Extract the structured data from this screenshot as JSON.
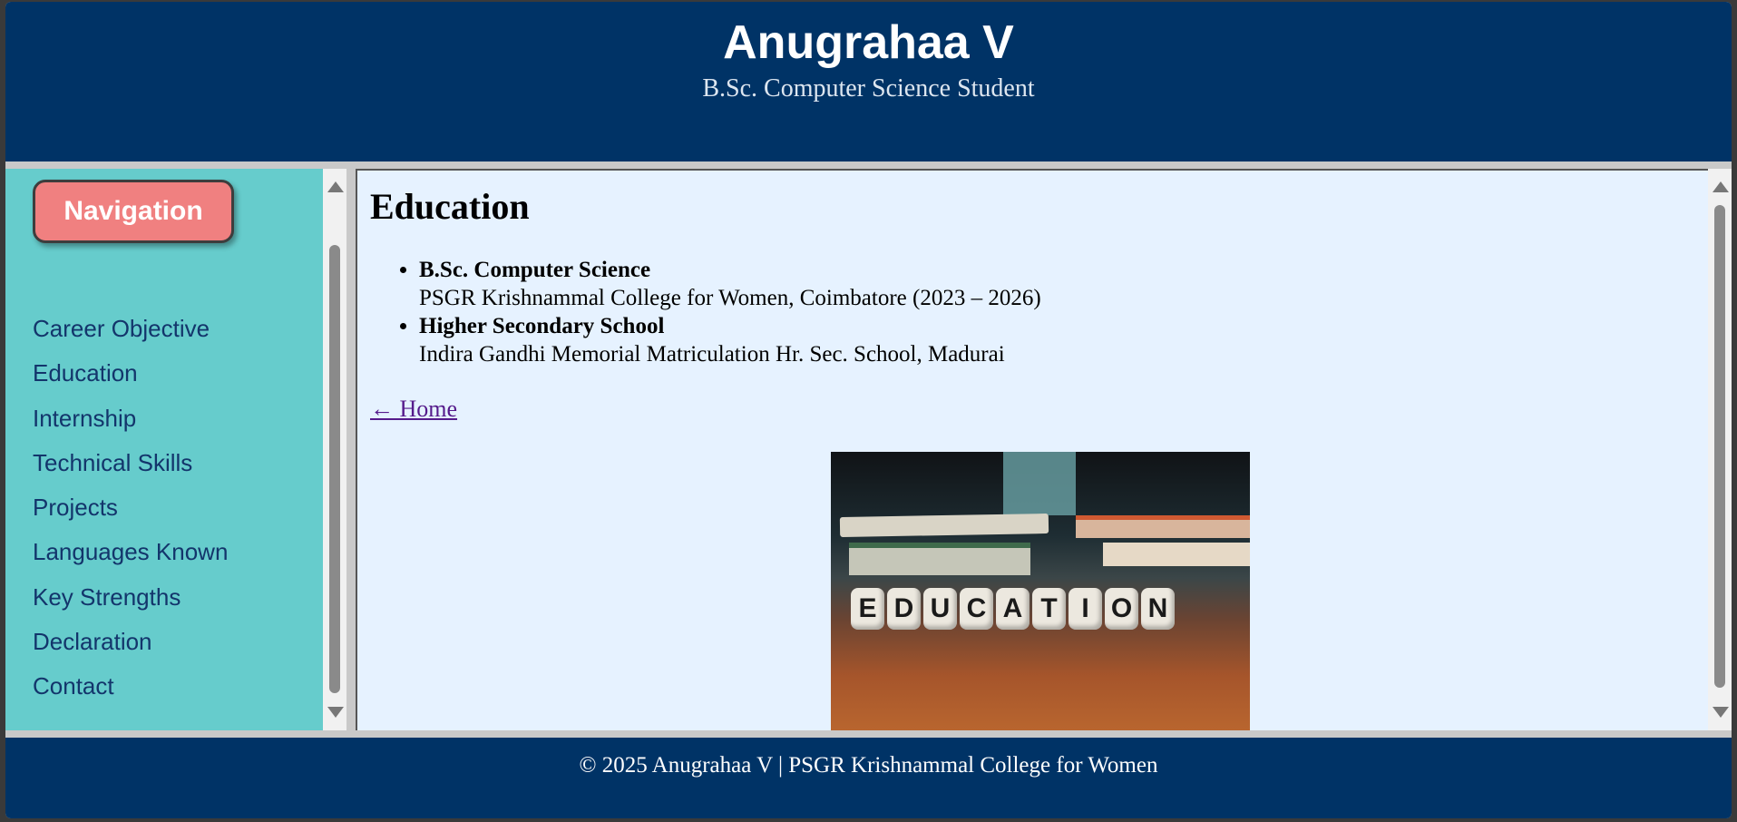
{
  "header": {
    "name": "Anugrahaa V",
    "role": "B.Sc. Computer Science Student"
  },
  "sidebar": {
    "button_label": "Navigation",
    "items": [
      {
        "label": "Career Objective"
      },
      {
        "label": "Education"
      },
      {
        "label": "Internship"
      },
      {
        "label": "Technical Skills"
      },
      {
        "label": "Projects"
      },
      {
        "label": "Languages Known"
      },
      {
        "label": "Key Strengths"
      },
      {
        "label": "Declaration"
      },
      {
        "label": "Contact"
      }
    ]
  },
  "main": {
    "heading": "Education",
    "entries": [
      {
        "degree": "B.Sc. Computer Science",
        "institution": "PSGR Krishnammal College for Women, Coimbatore (2023 – 2026)"
      },
      {
        "degree": "Higher Secondary School",
        "institution": "Indira Gandhi Memorial Matriculation Hr. Sec. School, Madurai"
      }
    ],
    "home_link": "← Home",
    "image": {
      "description_icon": "education-dice-photo",
      "dice_letters": [
        "E",
        "D",
        "U",
        "C",
        "A",
        "T",
        "I",
        "O",
        "N"
      ]
    }
  },
  "footer": {
    "text": "© 2025 Anugrahaa V | PSGR Krishnammal College for Women"
  },
  "colors": {
    "header_bg": "#003366",
    "sidebar_bg": "#66cccc",
    "nav_button": "#f08080",
    "main_bg": "#e6f2ff",
    "link_visited": "#551a8b"
  }
}
